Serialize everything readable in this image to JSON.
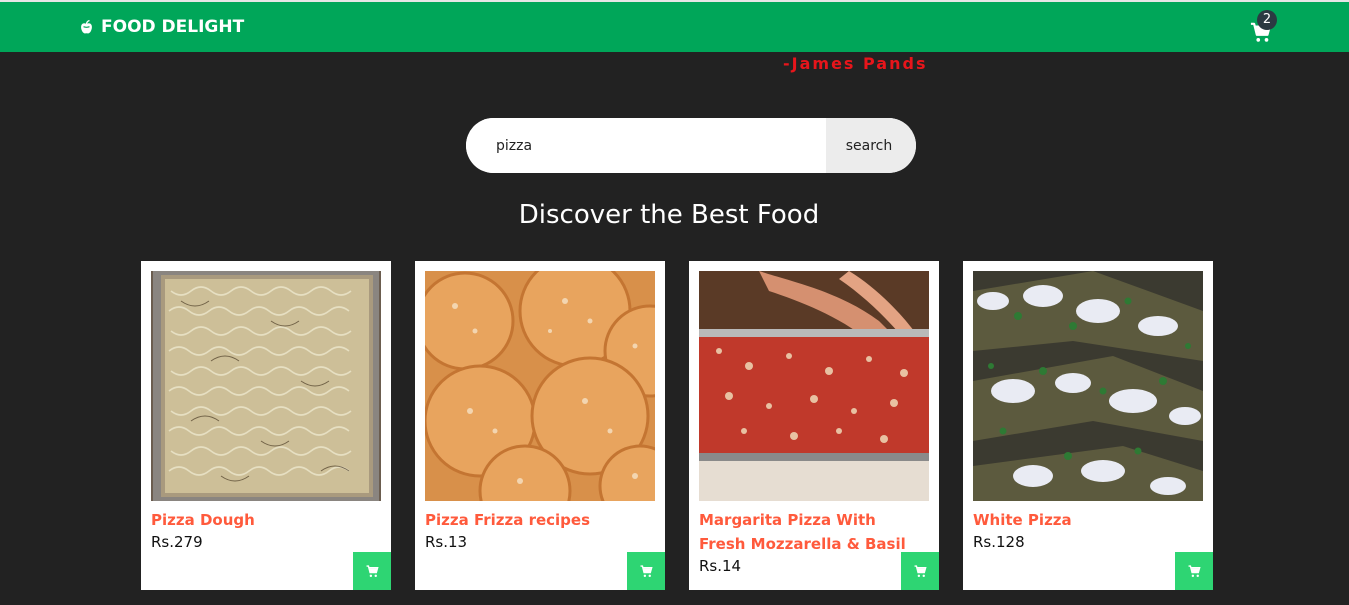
{
  "navbar": {
    "brand": "FOOD DELIGHT",
    "brand_icon": "apple-whole-icon",
    "cart_icon": "cart-icon",
    "cart_count": "2",
    "bg_color": "#00a659"
  },
  "quote": {
    "author": "-James Pands",
    "color": "#e8151b"
  },
  "search": {
    "value": "pizza",
    "button_label": "search"
  },
  "section": {
    "title": "Discover the Best Food"
  },
  "products": [
    {
      "title": "Pizza Dough",
      "price": "Rs.279"
    },
    {
      "title": "Pizza Frizza recipes",
      "price": "Rs.13"
    },
    {
      "title": "Margarita Pizza With Fresh Mozzarella & Basil",
      "price": "Rs.14"
    },
    {
      "title": "White Pizza",
      "price": "Rs.128"
    }
  ],
  "colors": {
    "title_accent": "#ff5a3c",
    "add_button": "#2ed573",
    "page_bg": "#222222"
  }
}
